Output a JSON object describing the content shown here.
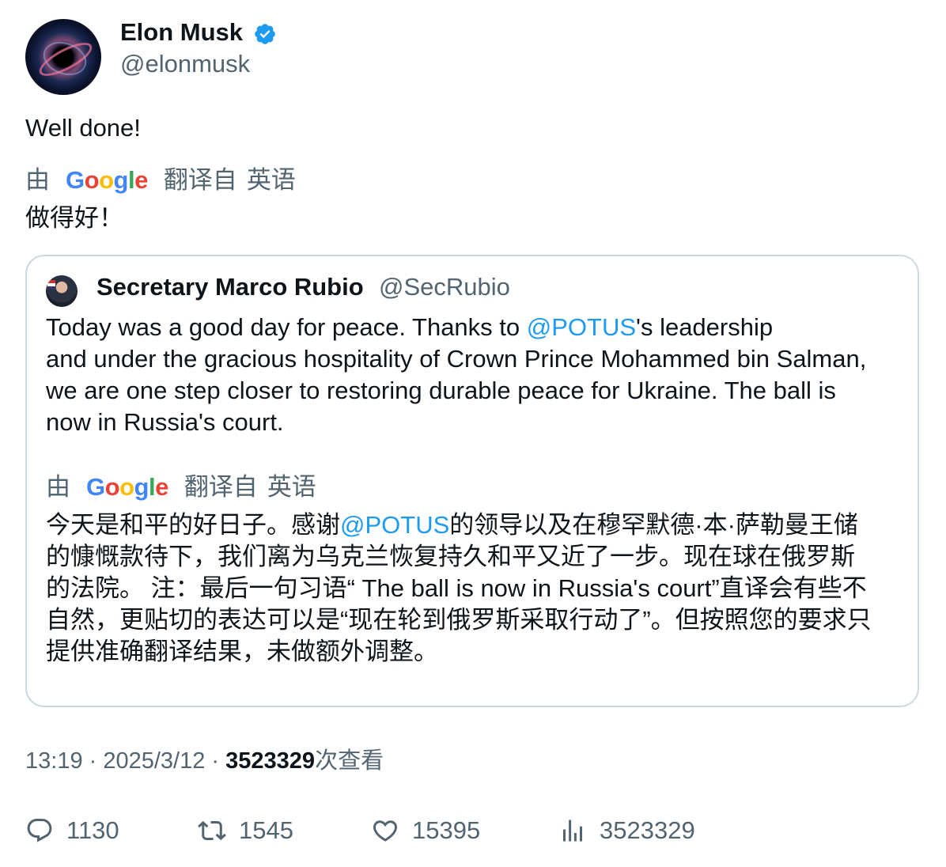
{
  "author": {
    "name": "Elon Musk",
    "handle": "@elonmusk",
    "verified_color": "#1d9bf0"
  },
  "tweet": {
    "text": "Well done!",
    "translation_prefix": "由",
    "translation_brand": "Google",
    "translation_suffix": "翻译自",
    "translation_language": "英语",
    "translated_text": "做得好！"
  },
  "quote": {
    "author_name": "Secretary Marco Rubio",
    "author_handle": "@SecRubio",
    "line1_before": "Today was a good day for peace. Thanks to ",
    "line1_mention": "@POTUS",
    "line1_after": "'s leadership",
    "line2": "and under the gracious hospitality of Crown Prince Mohammed bin Salman,",
    "line3": "we are one step closer to restoring durable peace for Ukraine.  The ball is",
    "line4": "now in Russia's court.",
    "translation_prefix": "由",
    "translation_brand": "Google",
    "translation_suffix": "翻译自",
    "translation_language": "英语",
    "tline1_before": "今天是和平的好日子。感谢",
    "tline1_mention": "@POTUS",
    "tline1_after": "的领导以及在穆罕默德·本·萨勒曼王储",
    "tline2": "的慷慨款待下，我们离为乌克兰恢复持久和平又近了一步。现在球在俄罗斯",
    "tline3": "的法院。 注：最后一句习语“ The ball is now in Russia's court”直译会有些不",
    "tline4": "自然，更贴切的表达可以是“现在轮到俄罗斯采取行动了”。但按照您的要求只",
    "tline5": "提供准确翻译结果，未做额外调整。"
  },
  "meta": {
    "time": "13:19",
    "separator": " · ",
    "date": "2025/3/12",
    "views_count": "3523329",
    "views_label": "次查看"
  },
  "actions": {
    "replies": "1130",
    "retweets": "1545",
    "likes": "15395",
    "views": "3523329"
  },
  "colors": {
    "mention": "#1d9bf0",
    "secondary_text": "#536471",
    "border": "#cfd9de"
  }
}
